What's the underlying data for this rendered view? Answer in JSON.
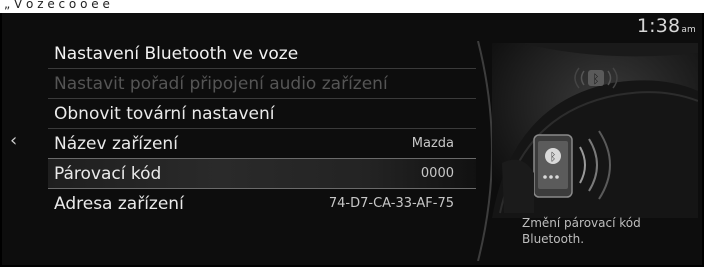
{
  "top_strip": {
    "text": "„ V o z e c o o e e"
  },
  "clock": {
    "time": "1:38",
    "ampm": "am"
  },
  "nav": {
    "back_icon": "chevron-left-icon"
  },
  "menu": {
    "items": [
      {
        "label": "Nastavení Bluetooth ve voze",
        "value": "",
        "state": "title"
      },
      {
        "label": "Nastavit pořadí připojení audio zařízení",
        "value": "",
        "state": "disabled"
      },
      {
        "label": "Obnovit tovární nastavení",
        "value": "",
        "state": "normal"
      },
      {
        "label": "Název zařízení",
        "value": "Mazda",
        "state": "normal"
      },
      {
        "label": "Párovací kód",
        "value": "0000",
        "state": "selected"
      },
      {
        "label": "Adresa zařízení",
        "value": "74-D7-CA-33-AF-75",
        "state": "normal"
      }
    ]
  },
  "hint": {
    "text": "Změní párovací kód Bluetooth."
  },
  "illustration": {
    "icon": "bluetooth-phone-car-illustration"
  },
  "colors": {
    "background": "#0d0d0d",
    "text": "#eaeaea",
    "disabled": "#555555",
    "selection": "#2a2a2a"
  }
}
